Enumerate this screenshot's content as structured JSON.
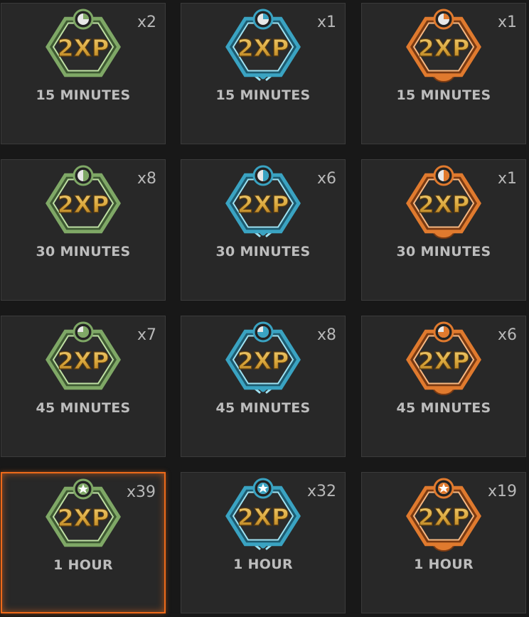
{
  "tokens": [
    {
      "count": "x2",
      "duration": "15 MINUTES",
      "tier": "green",
      "icon": "quarter",
      "label": "2XP",
      "selected": false
    },
    {
      "count": "x1",
      "duration": "15 MINUTES",
      "tier": "blue",
      "icon": "quarter",
      "label": "2XP",
      "selected": false
    },
    {
      "count": "x1",
      "duration": "15 MINUTES",
      "tier": "orange",
      "icon": "quarter",
      "label": "2XP",
      "selected": false
    },
    {
      "count": "x8",
      "duration": "30 MINUTES",
      "tier": "green",
      "icon": "half",
      "label": "2XP",
      "selected": false
    },
    {
      "count": "x6",
      "duration": "30 MINUTES",
      "tier": "blue",
      "icon": "half",
      "label": "2XP",
      "selected": false
    },
    {
      "count": "x1",
      "duration": "30 MINUTES",
      "tier": "orange",
      "icon": "half",
      "label": "2XP",
      "selected": false
    },
    {
      "count": "x7",
      "duration": "45 MINUTES",
      "tier": "green",
      "icon": "threequarter",
      "label": "2XP",
      "selected": false
    },
    {
      "count": "x8",
      "duration": "45 MINUTES",
      "tier": "blue",
      "icon": "threequarter",
      "label": "2XP",
      "selected": false
    },
    {
      "count": "x6",
      "duration": "45 MINUTES",
      "tier": "orange",
      "icon": "threequarter",
      "label": "2XP",
      "selected": false
    },
    {
      "count": "x39",
      "duration": "1 HOUR",
      "tier": "green",
      "icon": "star",
      "label": "2XP",
      "selected": true
    },
    {
      "count": "x32",
      "duration": "1 HOUR",
      "tier": "blue",
      "icon": "star",
      "label": "2XP",
      "selected": false
    },
    {
      "count": "x19",
      "duration": "1 HOUR",
      "tier": "orange",
      "icon": "star",
      "label": "2XP",
      "selected": false
    }
  ],
  "colors": {
    "green": {
      "main": "#7fa866",
      "dark": "#3f5a33",
      "light": "#bfe0a4"
    },
    "blue": {
      "main": "#3aa3c2",
      "dark": "#1d5b70",
      "light": "#9fe2f2"
    },
    "orange": {
      "main": "#e07a2e",
      "dark": "#7a3a12",
      "light": "#f7b882"
    },
    "selection": "#ee6a1a",
    "text_gold": "#e2b64a"
  }
}
